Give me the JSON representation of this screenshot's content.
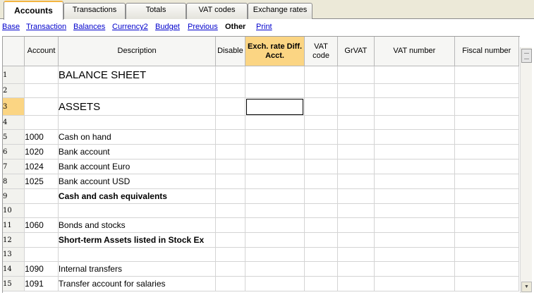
{
  "tabs": [
    {
      "label": "Accounts",
      "active": true
    },
    {
      "label": "Transactions",
      "active": false
    },
    {
      "label": "Totals",
      "active": false
    },
    {
      "label": "VAT codes",
      "active": false
    },
    {
      "label": "Exchange rates",
      "active": false
    }
  ],
  "views": [
    {
      "label": "Base"
    },
    {
      "label": "Transaction"
    },
    {
      "label": "Balances"
    },
    {
      "label": "Currency2"
    },
    {
      "label": "Budget"
    },
    {
      "label": "Previous"
    },
    {
      "label": "Other"
    },
    {
      "label": "Print"
    }
  ],
  "current_view": "Other",
  "columns": {
    "account": "Account",
    "description": "Description",
    "disable": "Disable",
    "exch_rate": "Exch. rate Diff. Acct.",
    "vat_code": "VAT code",
    "grvat": "GrVAT",
    "vat_number": "VAT number",
    "fiscal_number": "Fiscal number"
  },
  "current_row": "3",
  "rows": [
    {
      "n": "1",
      "account": "",
      "description": "BALANCE SHEET",
      "style": "big"
    },
    {
      "n": "2",
      "account": "",
      "description": "",
      "style": ""
    },
    {
      "n": "3",
      "account": "",
      "description": "ASSETS",
      "style": "big"
    },
    {
      "n": "4",
      "account": "",
      "description": "",
      "style": ""
    },
    {
      "n": "5",
      "account": "1000",
      "description": "Cash on hand",
      "style": ""
    },
    {
      "n": "6",
      "account": "1020",
      "description": "Bank account",
      "style": ""
    },
    {
      "n": "7",
      "account": "1024",
      "description": "Bank account Euro",
      "style": ""
    },
    {
      "n": "8",
      "account": "1025",
      "description": "Bank account USD",
      "style": ""
    },
    {
      "n": "9",
      "account": "",
      "description": "Cash and cash equivalents",
      "style": "bold"
    },
    {
      "n": "10",
      "account": "",
      "description": "",
      "style": ""
    },
    {
      "n": "11",
      "account": "1060",
      "description": "Bonds and stocks",
      "style": ""
    },
    {
      "n": "12",
      "account": "",
      "description": "Short-term Assets listed in Stock Ex",
      "style": "bold"
    },
    {
      "n": "13",
      "account": "",
      "description": "",
      "style": ""
    },
    {
      "n": "14",
      "account": "1090",
      "description": "Internal transfers",
      "style": ""
    },
    {
      "n": "15",
      "account": "1091",
      "description": "Transfer account for salaries",
      "style": ""
    }
  ],
  "scroll_up_icon": "triangle-up",
  "scroll_down_icon": "triangle-down"
}
